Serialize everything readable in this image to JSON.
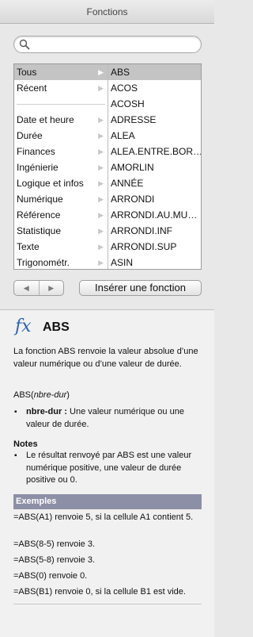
{
  "window": {
    "title": "Fonctions"
  },
  "search": {
    "placeholder": "",
    "value": ""
  },
  "categories": [
    {
      "label": "Tous",
      "selected": true
    },
    {
      "label": "Récent"
    },
    {
      "label": ""
    },
    {
      "label": "Date et heure"
    },
    {
      "label": "Durée"
    },
    {
      "label": "Finances"
    },
    {
      "label": "Ingénierie"
    },
    {
      "label": "Logique et infos"
    },
    {
      "label": "Numérique"
    },
    {
      "label": "Référence"
    },
    {
      "label": "Statistique"
    },
    {
      "label": "Texte"
    },
    {
      "label": "Trigonométr."
    }
  ],
  "functions": [
    "ABS",
    "ACOS",
    "ACOSH",
    "ADRESSE",
    "ALEA",
    "ALEA.ENTRE.BOR…",
    "AMORLIN",
    "ANNÉE",
    "ARRONDI",
    "ARRONDI.AU.MU…",
    "ARRONDI.INF",
    "ARRONDI.SUP",
    "ASIN"
  ],
  "nav": {
    "back_icon": "triangle-left-icon",
    "forward_icon": "triangle-right-icon"
  },
  "insert_button": {
    "label": "Insérer une fonction"
  },
  "help": {
    "fx_symbol": "fx",
    "function_name": "ABS",
    "description": "La fonction ABS renvoie la valeur absolue d’une valeur numérique ou d’une valeur de durée.",
    "syntax_name": "ABS(",
    "syntax_arg": "nbre-dur",
    "syntax_close": ")",
    "arg_name": "nbre-dur :",
    "arg_desc": " Une valeur numérique ou une valeur de durée.",
    "notes_title": "Notes",
    "note_1": "Le résultat renvoyé par ABS est une valeur numérique positive, une valeur de durée positive ou 0.",
    "examples_title": "Exemples",
    "examples": [
      "=ABS(A1) renvoie 5, si la cellule A1 contient 5.",
      "=ABS(8-5) renvoie 3.",
      "=ABS(5-8) renvoie 3.",
      "=ABS(0) renvoie 0.",
      "=ABS(B1) renvoie 0, si la cellule B1 est vide."
    ]
  },
  "colors": {
    "fx": "#2a62b8",
    "selection": "#c4c4c4",
    "examples_header": "#8d8fa6"
  }
}
